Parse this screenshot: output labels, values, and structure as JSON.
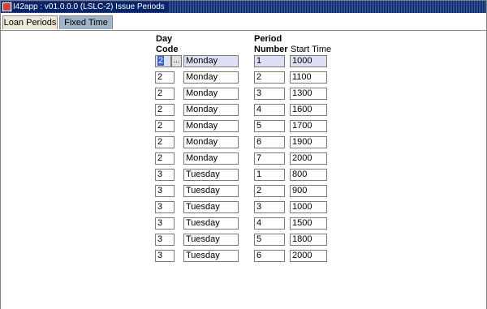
{
  "window": {
    "title": "I42app : v01.0.0.0 (LSLC-2) Issue Periods"
  },
  "tabs": [
    {
      "label": "Loan Periods",
      "active": true
    },
    {
      "label": "Fixed Time",
      "active": false
    }
  ],
  "headers": {
    "day_line1": "Day",
    "day_line2": "Code",
    "period_line1": "Period",
    "period_line2": "Number",
    "start_time": "Start Time"
  },
  "lov_button": "...",
  "rows": [
    {
      "day_code": "2",
      "day_name": "Monday",
      "period": "1",
      "start": "1000"
    },
    {
      "day_code": "2",
      "day_name": "Monday",
      "period": "2",
      "start": "1100"
    },
    {
      "day_code": "2",
      "day_name": "Monday",
      "period": "3",
      "start": "1300"
    },
    {
      "day_code": "2",
      "day_name": "Monday",
      "period": "4",
      "start": "1600"
    },
    {
      "day_code": "2",
      "day_name": "Monday",
      "period": "5",
      "start": "1700"
    },
    {
      "day_code": "2",
      "day_name": "Monday",
      "period": "6",
      "start": "1900"
    },
    {
      "day_code": "2",
      "day_name": "Monday",
      "period": "7",
      "start": "2000"
    },
    {
      "day_code": "3",
      "day_name": "Tuesday",
      "period": "1",
      "start": "800"
    },
    {
      "day_code": "3",
      "day_name": "Tuesday",
      "period": "2",
      "start": "900"
    },
    {
      "day_code": "3",
      "day_name": "Tuesday",
      "period": "3",
      "start": "1000"
    },
    {
      "day_code": "3",
      "day_name": "Tuesday",
      "period": "4",
      "start": "1500"
    },
    {
      "day_code": "3",
      "day_name": "Tuesday",
      "period": "5",
      "start": "1800"
    },
    {
      "day_code": "3",
      "day_name": "Tuesday",
      "period": "6",
      "start": "2000"
    }
  ],
  "colors": {
    "titlebar": "#0a246a",
    "active_row": "#dde0f5",
    "selection": "#3a5ec8",
    "inactive_tab": "#9fb4c8"
  }
}
